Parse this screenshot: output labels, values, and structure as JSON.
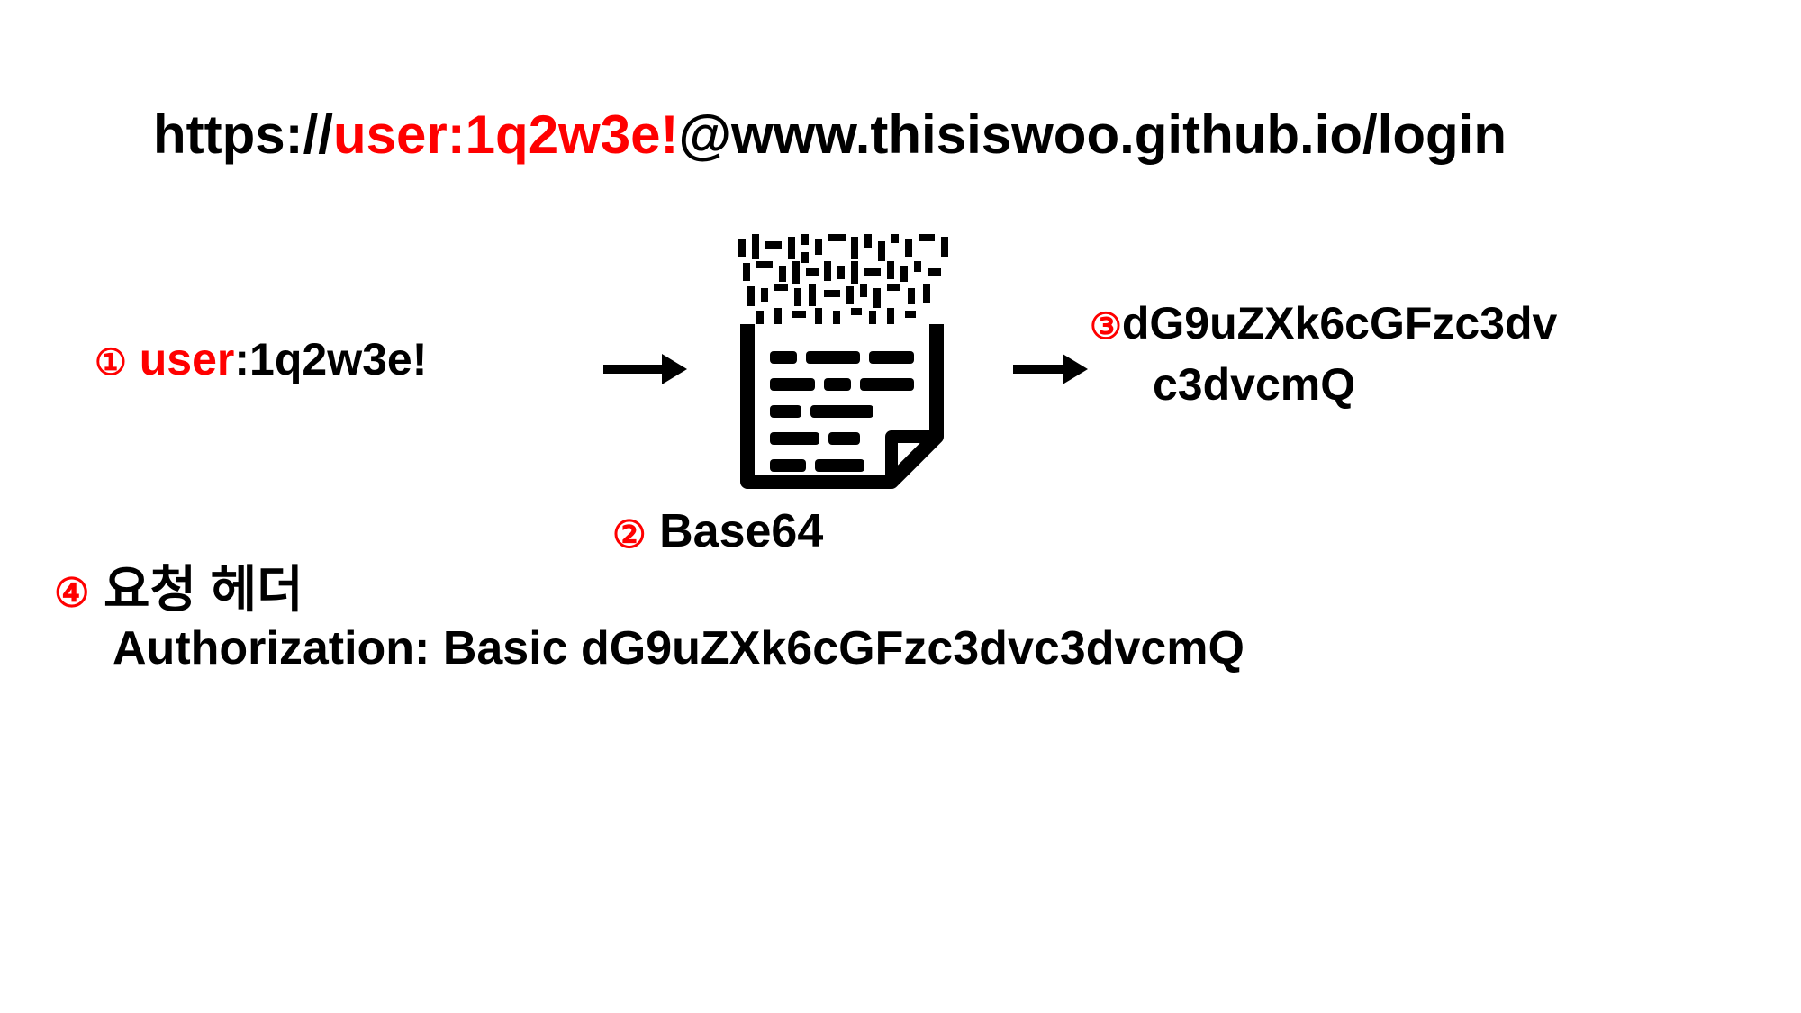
{
  "url": {
    "prefix": "https://",
    "credentials": "user:1q2w3e!",
    "suffix": "@www.thisiswoo.github.io/login"
  },
  "step1": {
    "marker": "①",
    "user": "user",
    "sep": ":",
    "pass": "1q2w3e!"
  },
  "step2": {
    "marker": "②",
    "label": "Base64"
  },
  "step3": {
    "marker": "③",
    "line1": "dG9uZXk6cGFzc3dv",
    "line2": "c3dvcmQ"
  },
  "step4": {
    "marker": "④",
    "label": "요청 헤더"
  },
  "auth_header": "Authorization: Basic dG9uZXk6cGFzc3dvc3dvcmQ"
}
